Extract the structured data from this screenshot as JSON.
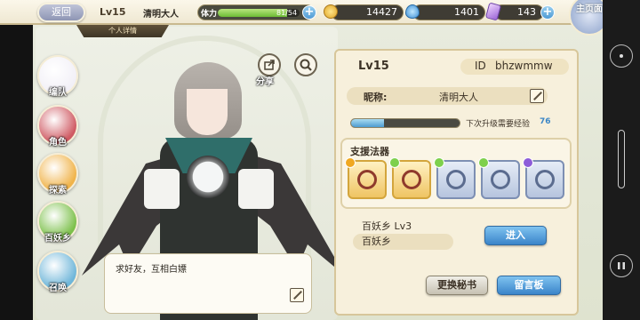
{
  "header": {
    "back_label": "返回",
    "level": "Lv15",
    "player_name": "清明大人",
    "stamina_label": "体力",
    "stamina_value": "81/54",
    "stamina_fraction": 0.85,
    "gold": "14427",
    "gems": "1401",
    "crystals": "143",
    "home_label": "主页面",
    "profile_tab": "个人详情"
  },
  "sidebar": {
    "items": [
      {
        "label": "编队",
        "color": "#f2f0f7"
      },
      {
        "label": "角色",
        "color": "#cf5a63"
      },
      {
        "label": "探索",
        "color": "#f0b34a"
      },
      {
        "label": "百妖乡",
        "color": "#7cc04b"
      },
      {
        "label": "召唤",
        "color": "#6fb6d9"
      }
    ]
  },
  "actions": {
    "share_label": "分享"
  },
  "bubble": {
    "text": "求好友，互相白嫖"
  },
  "profile": {
    "level": "Lv15",
    "id_label": "ID",
    "id_value": "bhzwmmw",
    "nickname_label": "昵称:",
    "nickname_value": "清明大人",
    "xp_label": "下次升级需要经验",
    "xp_value": "76",
    "xp_fraction": 0.3,
    "support_title": "支援法器",
    "artifacts": [
      {
        "name": "red-book-artifact",
        "gold": true,
        "gem": "#f0a820"
      },
      {
        "name": "green-orb-artifact",
        "gold": true,
        "gem": "#7ed04c"
      },
      {
        "name": "blue-dragon-artifact",
        "gold": false,
        "gem": "#7ed04c"
      },
      {
        "name": "silver-ring-artifact",
        "gold": false,
        "gem": "#7ed04c"
      },
      {
        "name": "dark-ring-artifact",
        "gold": false,
        "gem": "#8d5cd9"
      }
    ],
    "village_level": "百妖乡   Lv3",
    "village_name": "百妖乡",
    "enter_label": "进入",
    "change_secretary_label": "更换秘书",
    "message_board_label": "留言板"
  },
  "colors": {
    "accent_blue": "#3a84c9",
    "panel_bg": "#f7f0dc"
  }
}
